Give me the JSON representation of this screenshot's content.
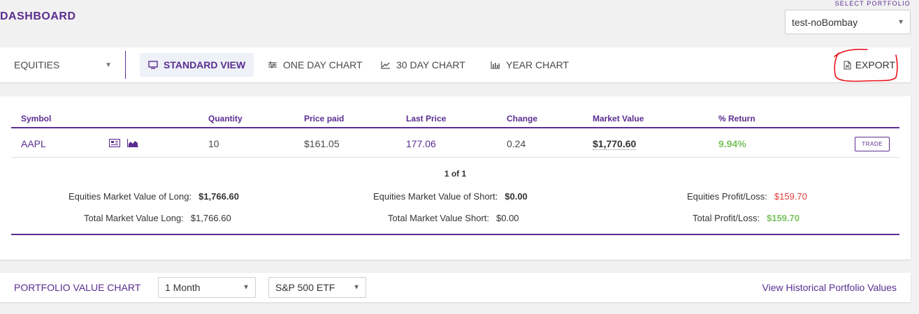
{
  "header": {
    "title": "DASHBOARD",
    "select_label": "SELECT PORTFOLIO",
    "portfolio": "test-noBombay"
  },
  "toolbar": {
    "asset_type": "EQUITIES",
    "views": [
      {
        "label": "STANDARD VIEW",
        "icon": "monitor-icon",
        "active": true
      },
      {
        "label": "ONE DAY CHART",
        "icon": "sliders-icon",
        "active": false
      },
      {
        "label": "30 DAY CHART",
        "icon": "line-chart-icon",
        "active": false
      },
      {
        "label": "YEAR CHART",
        "icon": "bar-chart-icon",
        "active": false
      }
    ],
    "export_label": "EXPORT"
  },
  "table": {
    "columns": [
      "Symbol",
      "Quantity",
      "Price paid",
      "Last Price",
      "Change",
      "Market Value",
      "% Return"
    ],
    "rows": [
      {
        "symbol": "AAPL",
        "quantity": "10",
        "price_paid": "$161.05",
        "last_price": "177.06",
        "change": "0.24",
        "market_value": "$1,770.60",
        "return": "9.94%",
        "trade_label": "TRADE"
      }
    ],
    "pagination": "1 of 1"
  },
  "summary": {
    "eq_mv_long_label": "Equities Market Value of Long:",
    "eq_mv_long": "$1,766.60",
    "eq_mv_short_label": "Equities Market Value of Short:",
    "eq_mv_short": "$0.00",
    "eq_pl_label": "Equities Profit/Loss:",
    "eq_pl": "$159.70",
    "total_mv_long_label": "Total Market Value Long:",
    "total_mv_long": "$1,766.60",
    "total_mv_short_label": "Total Market Value Short:",
    "total_mv_short": "$0.00",
    "total_pl_label": "Total Profit/Loss:",
    "total_pl": "$159.70"
  },
  "portfolio_chart": {
    "title": "PORTFOLIO VALUE CHART",
    "range": "1 Month",
    "benchmark": "S&P 500 ETF",
    "history_link": "View Historical Portfolio Values"
  },
  "colors": {
    "brand": "#5a2d91",
    "positive": "#7ac35f",
    "negative": "#e23b3b",
    "annotation": "#e8141b"
  }
}
